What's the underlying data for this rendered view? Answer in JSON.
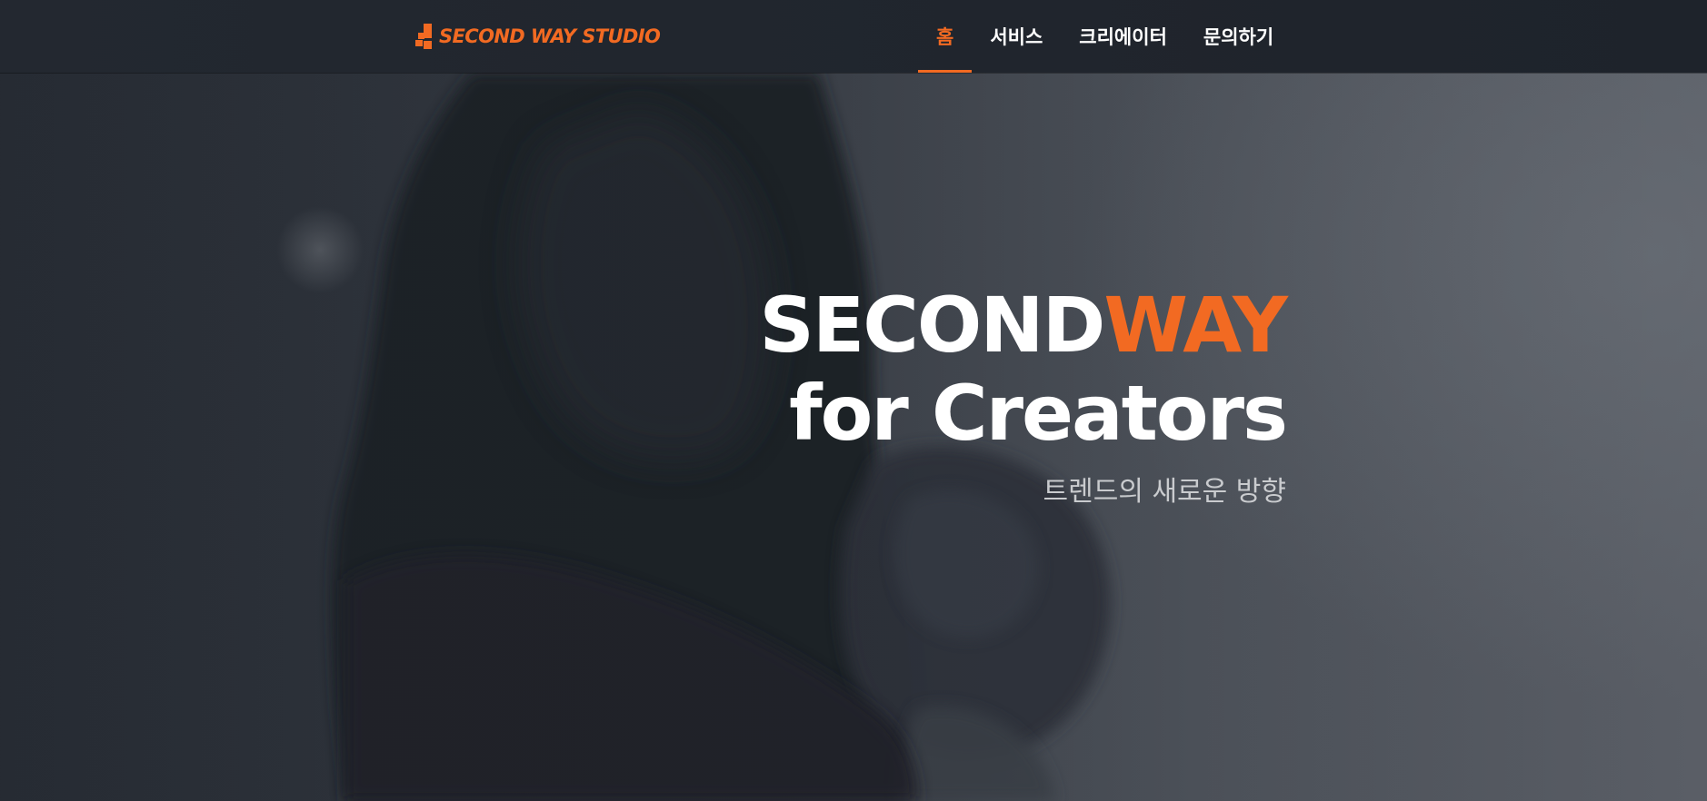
{
  "brand": {
    "name": "SECOND WAY STUDIO",
    "accent_color": "#f26a22",
    "icon": "second-way-logo-mark"
  },
  "nav": {
    "items": [
      {
        "label": "홈",
        "active": true
      },
      {
        "label": "서비스",
        "active": false
      },
      {
        "label": "크리에이터",
        "active": false
      },
      {
        "label": "문의하기",
        "active": false
      }
    ]
  },
  "hero": {
    "title_part1": "SECOND",
    "title_accent": "WAY",
    "title_line2": "for Creators",
    "subtitle": "트렌드의 새로운 방향"
  }
}
